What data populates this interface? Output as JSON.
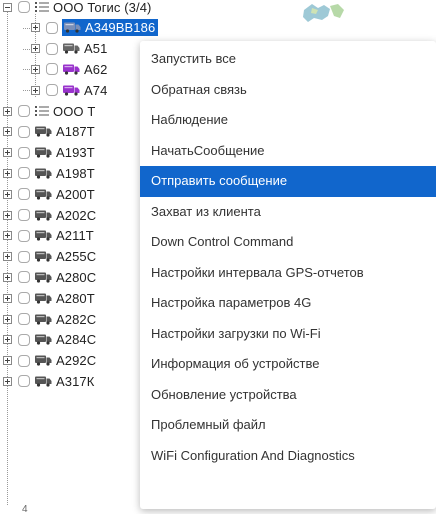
{
  "tree": {
    "groups": [
      {
        "label": "ООО Тогис  (3/4)",
        "expanded": true
      },
      {
        "label": "ООО Т",
        "expanded": false
      }
    ],
    "group_children": [
      {
        "label": "А349ВВ186",
        "color": "#7a8fb8",
        "selected": true
      },
      {
        "label": "А51",
        "color": "#666666",
        "selected": false
      },
      {
        "label": "А62",
        "color": "#9933cc",
        "selected": false
      },
      {
        "label": "А74",
        "color": "#9933cc",
        "selected": false
      }
    ],
    "vehicles": [
      "А187Т",
      "А193Т",
      "А198Т",
      "А200Т",
      "А202С",
      "А211Т",
      "А255С",
      "А280С",
      "А280Т",
      "А282С",
      "А284С",
      "А292С",
      "А317К"
    ],
    "vehicle_color": "#555555"
  },
  "context_menu": {
    "items": [
      {
        "label": "Запустить все",
        "active": false
      },
      {
        "label": "Обратная связь",
        "active": false
      },
      {
        "label": "Наблюдение",
        "active": false
      },
      {
        "label": "НачатьСообщение",
        "active": false
      },
      {
        "label": "Отправить сообщение",
        "active": true
      },
      {
        "label": "Захват из клиента",
        "active": false
      },
      {
        "label": "Down Control Command",
        "active": false
      },
      {
        "label": "Настройки интервала GPS-отчетов",
        "active": false
      },
      {
        "label": "Настройка параметров 4G",
        "active": false
      },
      {
        "label": "Настройки загрузки по Wi-Fi",
        "active": false
      },
      {
        "label": "Информация об устройстве",
        "active": false
      },
      {
        "label": "Обновление устройства",
        "active": false
      },
      {
        "label": "Проблемный файл",
        "active": false
      },
      {
        "label": "WiFi Configuration And Diagnostics",
        "active": false
      }
    ],
    "accent": "#1166cc"
  },
  "footer": {
    "tick": "4"
  }
}
